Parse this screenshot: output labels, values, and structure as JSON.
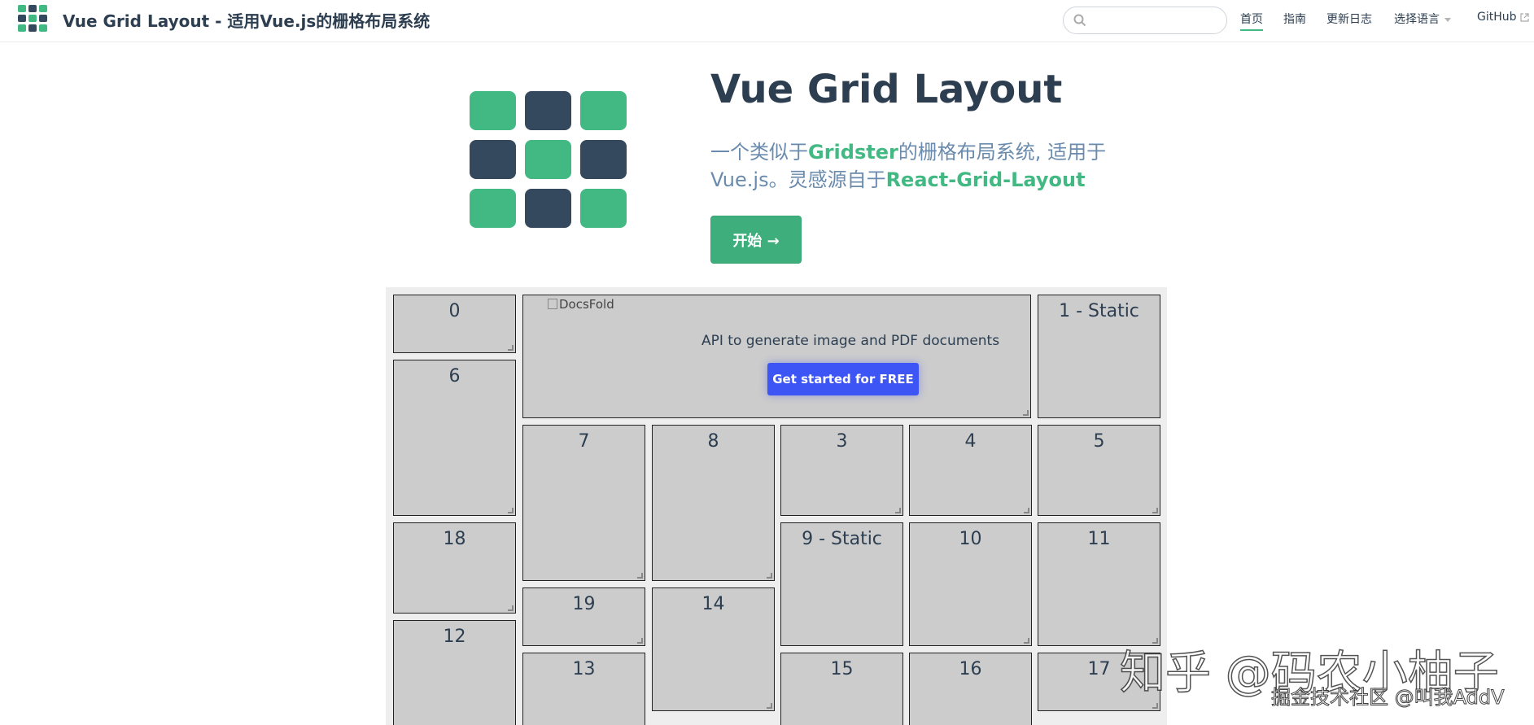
{
  "header": {
    "site_title": "Vue Grid Layout - 适用Vue.js的栅格布局系统",
    "search": {
      "value": "",
      "placeholder": ""
    },
    "nav": [
      {
        "label": "首页",
        "active": true
      },
      {
        "label": "指南"
      },
      {
        "label": "更新日志"
      },
      {
        "label": "选择语言",
        "dropdown": true
      },
      {
        "label": "GitHub",
        "external": true
      }
    ]
  },
  "hero": {
    "title": "Vue Grid Layout",
    "desc_part1": "一个类似于",
    "desc_link1": "Gridster",
    "desc_part2": "的栅格布局系统, 适用于Vue.js。灵感源自于",
    "desc_link2": "React-Grid-Layout",
    "start_label": "开始 →",
    "logo_cells": [
      "green",
      "dark",
      "green",
      "dark",
      "green",
      "dark",
      "green",
      "dark",
      "green"
    ]
  },
  "grid": {
    "items": [
      {
        "label": "0"
      },
      {
        "label": "1 - Static"
      },
      {
        "label": "6"
      },
      {
        "label": "7"
      },
      {
        "label": "8"
      },
      {
        "label": "3"
      },
      {
        "label": "4"
      },
      {
        "label": "5"
      },
      {
        "label": "18"
      },
      {
        "label": "9 - Static"
      },
      {
        "label": "10"
      },
      {
        "label": "11"
      },
      {
        "label": "19"
      },
      {
        "label": "14"
      },
      {
        "label": "12"
      },
      {
        "label": "13"
      },
      {
        "label": "15"
      },
      {
        "label": "16"
      },
      {
        "label": "17"
      }
    ],
    "ad": {
      "image_alt": "DocsFold",
      "text": "API to generate image and PDF documents",
      "button": "Get started for FREE"
    }
  },
  "watermark": {
    "main": "知乎 @码农小柚子",
    "sub": "掘金技术社区 @叫我AddV"
  },
  "colors": {
    "green": "#42b883",
    "dark": "#35495e",
    "accent": "#3eaf7c",
    "ad_button": "#3d55f5"
  }
}
